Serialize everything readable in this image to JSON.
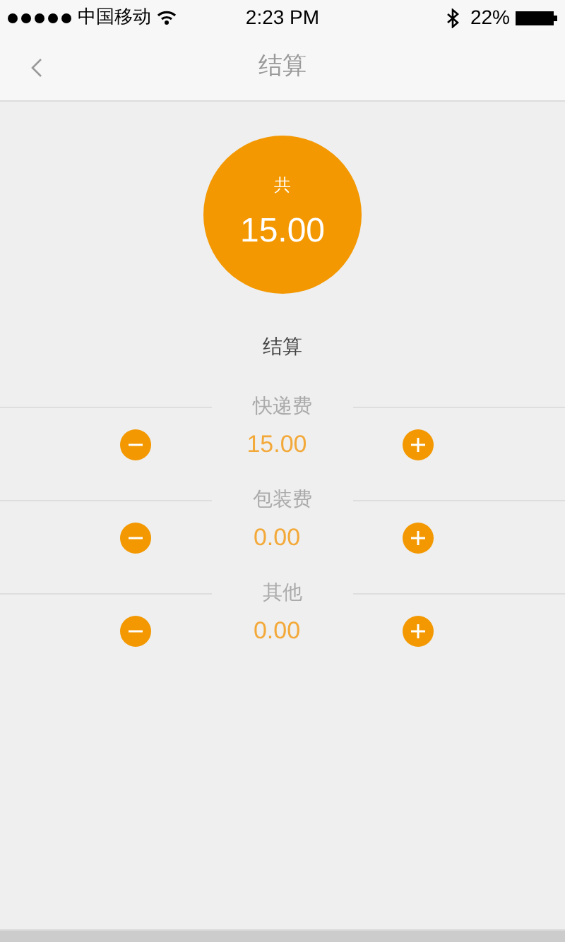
{
  "status_bar": {
    "carrier": "中国移动",
    "time": "2:23 PM",
    "battery": "22%"
  },
  "nav": {
    "title": "结算"
  },
  "total": {
    "label": "共",
    "amount": "15.00"
  },
  "section_title": "结算",
  "fees": [
    {
      "label": "快递费",
      "value": "15.00"
    },
    {
      "label": "包装费",
      "value": "0.00"
    },
    {
      "label": "其他",
      "value": "0.00"
    }
  ]
}
